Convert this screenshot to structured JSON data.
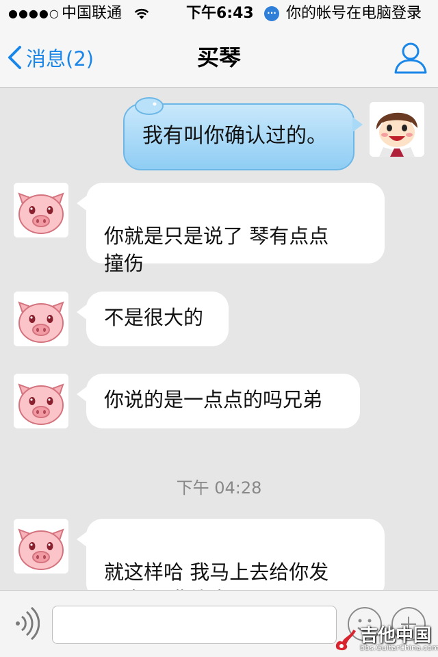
{
  "status_bar": {
    "signal": "●●●●○",
    "carrier": "中国联通",
    "time": "下午6:43",
    "qq_badge": "···",
    "login_note": "你的帐号在电脑登录"
  },
  "nav": {
    "back_label": "消息(2)",
    "title": "买琴"
  },
  "messages": [
    {
      "sender": "me",
      "text": "我有叫你确认过的。"
    },
    {
      "sender": "other",
      "text": "你就是只是说了 琴有点点\n撞伤"
    },
    {
      "sender": "other",
      "text": "不是很大的"
    },
    {
      "sender": "other",
      "text": "你说的是一点点的吗兄弟"
    },
    {
      "sender": "other",
      "text": "就这样哈 我马上去给你发\n回来  运费我出"
    }
  ],
  "timestamp": "下午 04:28",
  "input": {
    "value": "",
    "placeholder": ""
  },
  "watermark": {
    "title": "吉他中国",
    "url": "bbs.GuitarChina.com"
  },
  "colors": {
    "accent": "#1a86e8",
    "my_bubble": "#a8d9f7",
    "background": "#e6e6e6"
  }
}
